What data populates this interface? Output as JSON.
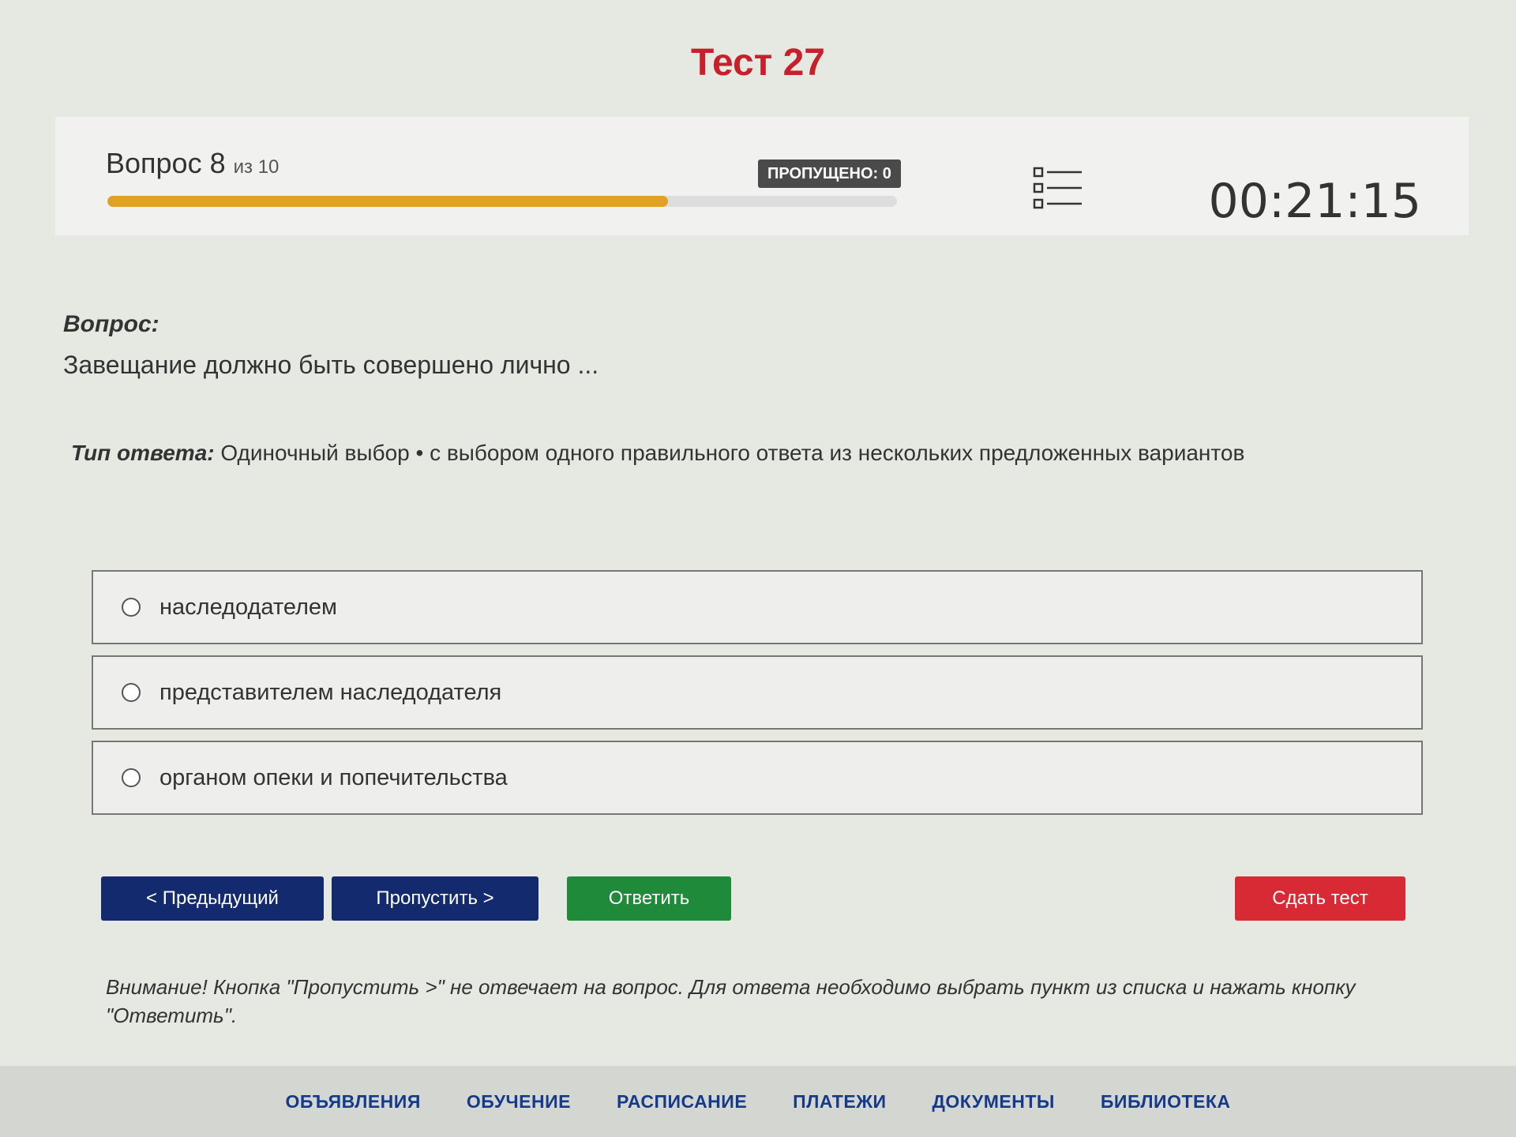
{
  "page_title": "Тест 27",
  "status": {
    "question_word": "Вопрос 8",
    "question_of": "из 10",
    "progress_fraction": 0.71,
    "skipped_badge": "ПРОПУЩЕНО: 0",
    "timer": "00:21:15"
  },
  "question": {
    "label": "Вопрос:",
    "text": "Завещание должно быть совершено лично ..."
  },
  "answer_type": {
    "label": "Тип ответа:",
    "value": " Одиночный выбор • с выбором одного правильного ответа из нескольких предложенных вариантов"
  },
  "options": [
    {
      "label": "наследодателем",
      "selected": false
    },
    {
      "label": "представителем наследодателя",
      "selected": false
    },
    {
      "label": "органом опеки и попечительства",
      "selected": false
    }
  ],
  "buttons": {
    "prev": "< Предыдущий",
    "skip": "Пропустить >",
    "answer": "Ответить",
    "submit": "Сдать тест"
  },
  "notice": "Внимание! Кнопка \"Пропустить >\" не отвечает на вопрос. Для ответа необходимо выбрать пункт из списка и нажать кнопку \"Ответить\".",
  "footer": {
    "links": [
      "ОБЪЯВЛЕНИЯ",
      "ОБУЧЕНИЕ",
      "РАСПИСАНИЕ",
      "ПЛАТЕЖИ",
      "ДОКУМЕНТЫ",
      "БИБЛИОТЕКА"
    ]
  },
  "colors": {
    "title": "#c8202a",
    "progress": "#e0a222",
    "nav_button": "#142a6e",
    "answer_button": "#1e8a3a",
    "submit_button": "#d82a34",
    "footer_link": "#163a8a"
  },
  "icons": {
    "question_list": "list-icon"
  }
}
